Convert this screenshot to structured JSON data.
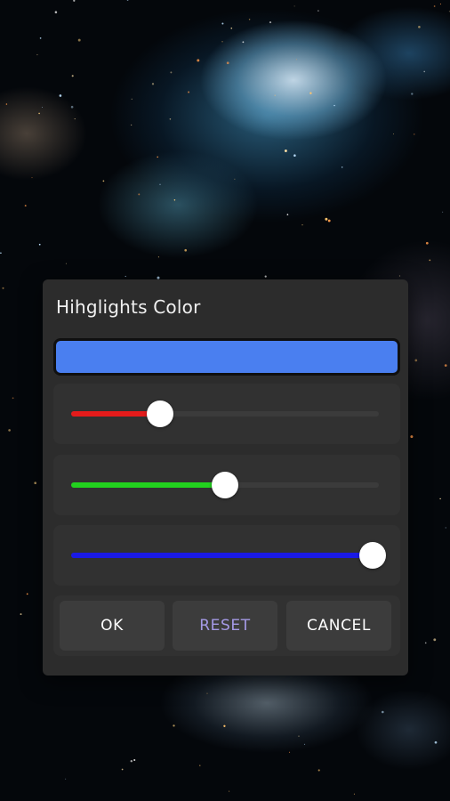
{
  "dialog": {
    "title": "Hihglights Color",
    "preview_color": "#4a7ff0"
  },
  "sliders": [
    {
      "channel": "red",
      "color": "#e41b1b",
      "value_fraction": 0.29
    },
    {
      "channel": "green",
      "color": "#22d11e",
      "value_fraction": 0.5
    },
    {
      "channel": "blue",
      "color": "#1a1ae6",
      "value_fraction": 0.98
    }
  ],
  "buttons": {
    "ok_label": "OK",
    "reset_label": "RESET",
    "cancel_label": "CANCEL",
    "ok_color": "#ffffff",
    "reset_color": "#a59ae6",
    "cancel_color": "#ffffff"
  }
}
